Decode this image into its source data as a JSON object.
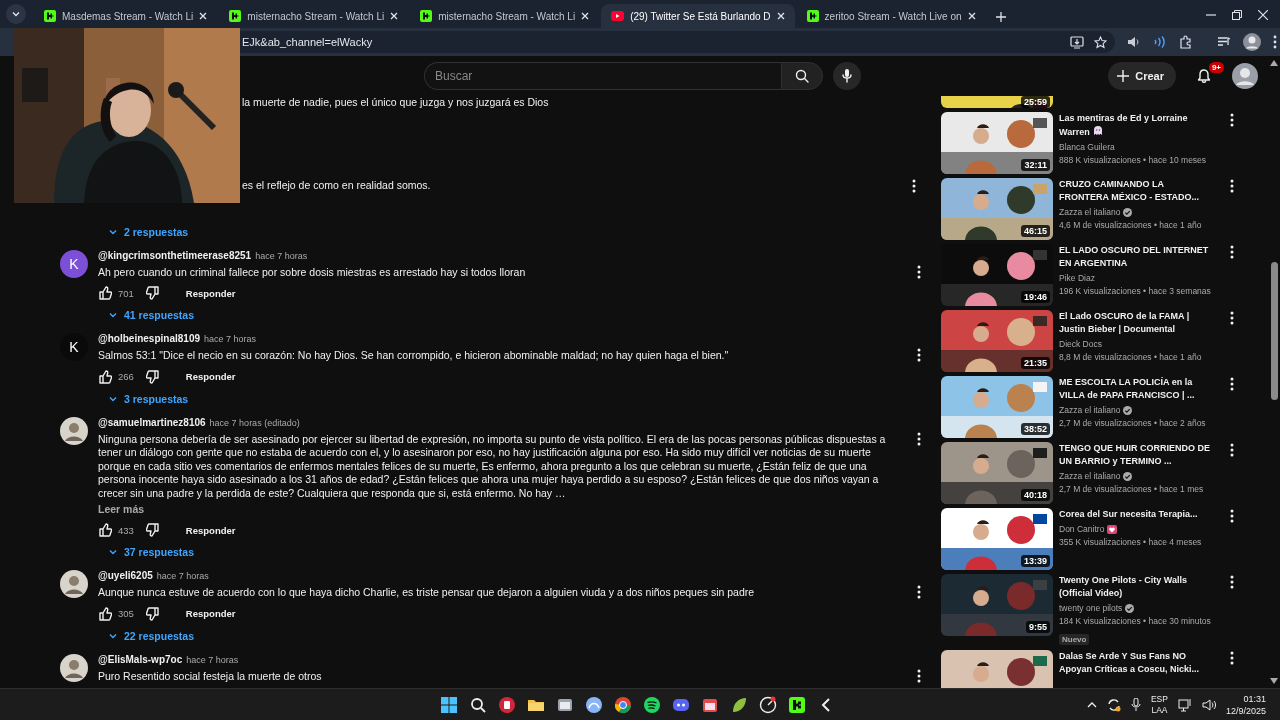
{
  "browser": {
    "tabs": [
      {
        "title": "Masdemas Stream - Watch Li",
        "kind": "kick",
        "selected": false
      },
      {
        "title": "misternacho Stream - Watch Li",
        "kind": "kick",
        "selected": false
      },
      {
        "title": "misternacho Stream - Watch Li",
        "kind": "kick",
        "selected": false
      },
      {
        "title": "(29) Twitter Se Está Burlando D",
        "kind": "youtube",
        "selected": true
      },
      {
        "title": "zeritoo Stream - Watch Live on",
        "kind": "kick",
        "selected": false
      }
    ],
    "address": {
      "url": "EJk&ab_channel=elWacky"
    }
  },
  "header": {
    "search": {
      "placeholder": "Buscar"
    },
    "create_button": "Crear",
    "notifications_badge": "9+"
  },
  "comments": [
    {
      "kind": "partial",
      "lines": [
        "la muerte de nadie, pues el único que juzga y nos juzgará es Dios",
        "es el reflejo de como en realidad somos."
      ],
      "replies": "2 respuestas"
    },
    {
      "kind": "full",
      "avatar": {
        "kind": "letter",
        "letter": "K",
        "color": "#7b4fd6"
      },
      "author": "@kingcrimsonthetimeerase8251",
      "time": "hace 7 horas",
      "text": "Ah pero cuando un criminal fallece por sobre dosis miestras es arrestado hay si todos lloran",
      "likes": "701",
      "reply": "Responder",
      "replies": "41 respuestas"
    },
    {
      "kind": "full",
      "avatar": {
        "kind": "letter",
        "letter": "K",
        "color": "#0a0a0a"
      },
      "author": "@holbeinespinal8109",
      "time": "hace 7 horas",
      "text": "Salmos 53:1 \"Dice el necio en su corazón: No hay Dios. Se han corrompido, e hicieron abominable maldad; no hay quien haga el bien.\"",
      "likes": "266",
      "reply": "Responder",
      "replies": "3 respuestas"
    },
    {
      "kind": "full",
      "author": "@samuelmartinez8106",
      "time": "hace 7 horas (editado)",
      "text": "Ninguna persona debería de ser asesinado por ejercer su libertad de expresión, no importa su punto de vista político. El era de las pocas personas públicas dispuestas a tener un diálogo con gente que no estaba de acuerdo con el, y lo asesinaron por eso, no hay justificación alguna por eso. Ha sido muy difícil ver noticias de su muerte porque en cada sitio ves comentarios de enfermos mentales felices de su muerte, Es enfermo, ahora pregunto a los que celebran su muerte, ¿Están feliz de que una persona inocente haya sido asesinado a los 31 años de edad? ¿Están felices que ahora una mujer haya perdido a su esposo? ¿Están felices de que dos niños vayan a crecer sin una padre y la perdida de este? Cualquiera que responda que si, está enfermo. No hay …",
      "more": "Leer más",
      "likes": "433",
      "reply": "Responder",
      "replies": "37 respuestas"
    },
    {
      "kind": "full",
      "author": "@uyeli6205",
      "time": "hace 7 horas",
      "text": "Aunque nunca estuve de acuerdo con lo que haya dicho Charlie, es triste pensar que dejaron a alguien viuda y a dos niños peques sin padre",
      "likes": "305",
      "reply": "Responder",
      "replies": "22 respuestas"
    },
    {
      "kind": "full",
      "author": "@ElisMals-wp7oc",
      "time": "hace 7 horas",
      "text": "Puro Resentido social festeja  la muerte de otros"
    }
  ],
  "videos": [
    {
      "kind": "partial",
      "duration": "25:59"
    },
    {
      "kind": "full",
      "title": "Las mentiras de Ed y Lorraine Warren",
      "title_icon": {
        "kind": "ghost"
      },
      "channel": {
        "name": "Blanca Guilera",
        "kind": "plain"
      },
      "meta": "888 K visualizaciones • hace 10 meses",
      "duration": "32:11"
    },
    {
      "kind": "full",
      "title": "CRUZO CAMINANDO LA FRONTERA MÉXICO - ESTADO...",
      "channel": {
        "name": "Zazza el italiano",
        "kind": "verified"
      },
      "meta": "4,6 M de visualizaciones • hace 1 año",
      "duration": "46:15"
    },
    {
      "kind": "full",
      "title": "EL LADO OSCURO DEL INTERNET EN ARGENTINA",
      "channel": {
        "name": "Pike Diaz",
        "kind": "plain"
      },
      "meta": "196 K visualizaciones • hace 3 semanas",
      "duration": "19:46"
    },
    {
      "kind": "full",
      "title": "El Lado OSCURO de la FAMA | Justin Bieber | Documental",
      "channel": {
        "name": "Dieck Docs",
        "kind": "plain"
      },
      "meta": "8,8 M de visualizaciones • hace 1 año",
      "duration": "21:35"
    },
    {
      "kind": "full",
      "title": "ME ESCOLTA LA POLICÍA en la VILLA de PAPA FRANCISCO | ...",
      "channel": {
        "name": "Zazza el italiano",
        "kind": "verified"
      },
      "meta": "2,7 M de visualizaciones • hace 2 años",
      "duration": "38:52"
    },
    {
      "kind": "full",
      "title": "TENGO QUE HUIR CORRIENDO DE UN BARRIO y TERMINO ...",
      "channel": {
        "name": "Zazza el italiano",
        "kind": "verified"
      },
      "meta": "2,7 M de visualizaciones • hace 1 mes",
      "duration": "40:18"
    },
    {
      "kind": "full",
      "title": "Corea del Sur necesita Terapia...",
      "channel": {
        "name": "Don Canitro",
        "kind": "heart"
      },
      "meta": "355 K visualizaciones • hace 4 meses",
      "duration": "13:39"
    },
    {
      "kind": "full",
      "title": "Twenty One Pilots - City Walls (Official Video)",
      "channel": {
        "name": "twenty one pilots",
        "kind": "verified"
      },
      "meta": "184 K visualizaciones • hace 30 minutos",
      "duration": "9:55",
      "badge": "Nuevo"
    },
    {
      "kind": "full",
      "title": "Dalas Se Arde Y Sus Fans NO Apoyan Críticas a Coscu, Nicki..."
    }
  ],
  "taskbar": {
    "language": "ESP",
    "layout": "LAA",
    "time": "01:31",
    "date": "12/9/2025"
  }
}
